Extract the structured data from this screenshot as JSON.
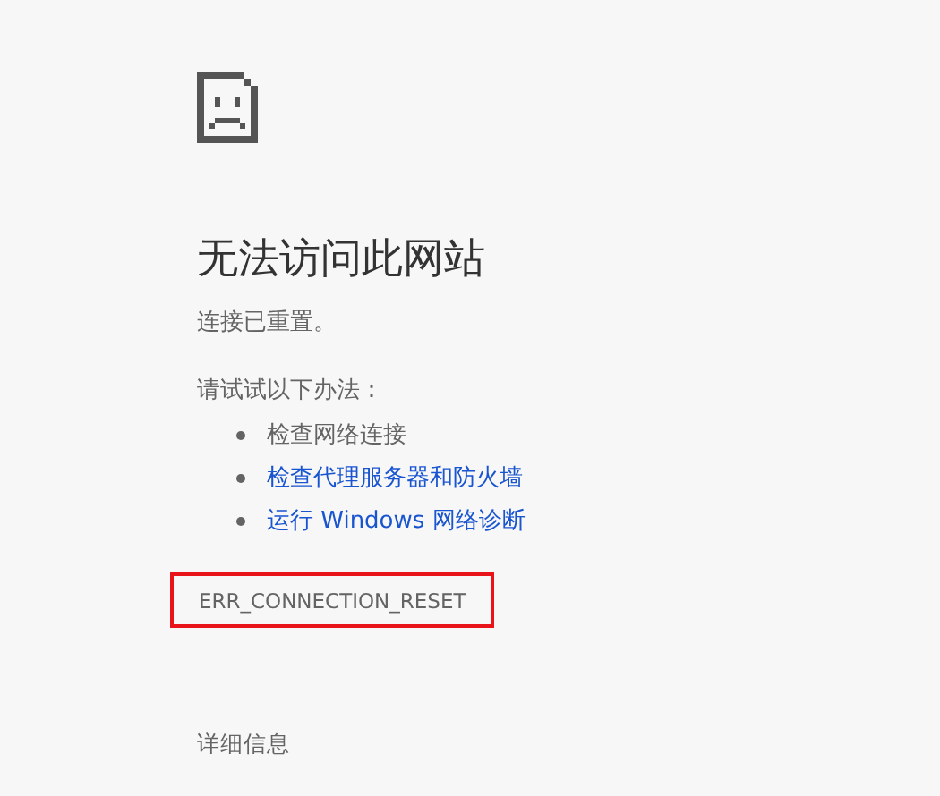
{
  "title": "无法访问此网站",
  "message": "连接已重置。",
  "suggestions_heading": "请试试以下办法：",
  "suggestions": [
    {
      "kind": "text",
      "label": "检查网络连接"
    },
    {
      "kind": "link",
      "label": "检查代理服务器和防火墙"
    },
    {
      "kind": "link",
      "label": "运行 Windows 网络诊断"
    }
  ],
  "error_code": {
    "text": "ERR_CONNECTION_RESET",
    "highlighted": true
  },
  "details_button": "详细信息"
}
